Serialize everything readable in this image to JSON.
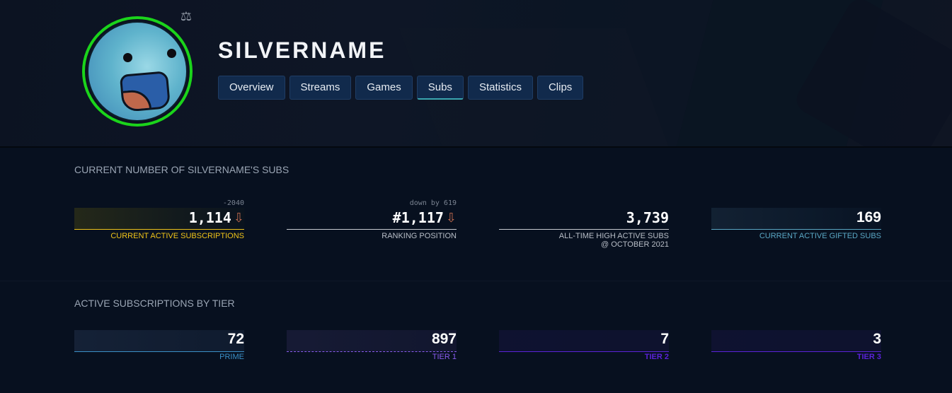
{
  "header": {
    "channel_name": "SILVERNAME",
    "tabs": [
      {
        "label": "Overview",
        "active": false
      },
      {
        "label": "Streams",
        "active": false
      },
      {
        "label": "Games",
        "active": false
      },
      {
        "label": "Subs",
        "active": true
      },
      {
        "label": "Statistics",
        "active": false
      },
      {
        "label": "Clips",
        "active": false
      }
    ],
    "partner_badge_icon": "scale-icon",
    "avatar_ring_color": "#1bd41b"
  },
  "current_subs": {
    "title": "CURRENT NUMBER OF SILVERNAME'S SUBS",
    "stats": [
      {
        "value": "1,114",
        "delta": "-2040",
        "trend": "down",
        "trend_icon": "⇩",
        "label": "CURRENT ACTIVE SUBSCRIPTIONS",
        "color": "#f0c419"
      },
      {
        "value": "#1,117",
        "delta": "down by 619",
        "trend": "down",
        "trend_icon": "⇩",
        "label": "RANKING POSITION",
        "color": "#c8ccd2"
      },
      {
        "value": "3,739",
        "label": "ALL-TIME HIGH ACTIVE SUBS",
        "sublabel": "@ OCTOBER 2021",
        "color": "#c8ccd2"
      },
      {
        "value": "169",
        "label": "CURRENT ACTIVE GIFTED SUBS",
        "color": "#5aa7c4"
      }
    ]
  },
  "by_tier": {
    "title": "ACTIVE SUBSCRIPTIONS BY TIER",
    "tiers": [
      {
        "value": "72",
        "label": "PRIME",
        "color": "#3a8fc6"
      },
      {
        "value": "897",
        "label": "TIER 1",
        "color": "#8a5cf0"
      },
      {
        "value": "7",
        "label": "TIER 2",
        "color": "#5a22d8"
      },
      {
        "value": "3",
        "label": "TIER 3",
        "color": "#5a22d8"
      }
    ]
  }
}
